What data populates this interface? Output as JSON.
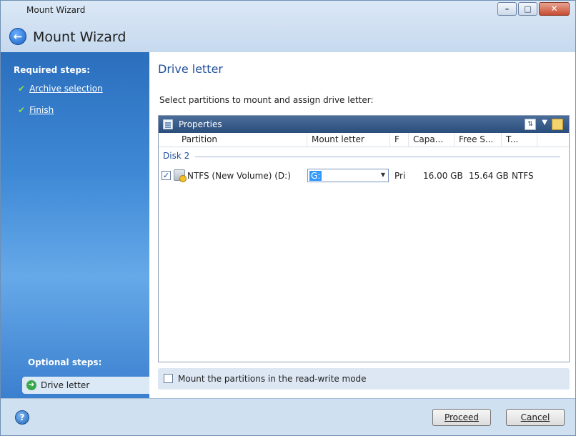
{
  "window": {
    "title": "Mount Wizard",
    "controls": {
      "minimize": "–",
      "maximize": "□",
      "close": "✕"
    }
  },
  "header": {
    "back_icon": "back-arrow-icon",
    "wizard_title": "Mount Wizard"
  },
  "sidebar": {
    "required_heading": "Required steps:",
    "required_steps": [
      {
        "label": "Archive selection",
        "icon": "check-icon"
      },
      {
        "label": "Finish",
        "icon": "check-icon"
      }
    ],
    "optional_heading": "Optional steps:",
    "optional_steps": [
      {
        "label": "Drive letter",
        "icon": "green-arrow-icon"
      }
    ]
  },
  "main": {
    "section_title": "Drive letter",
    "instruction": "Select partitions to mount and assign drive letter:",
    "grid": {
      "toolbar_label": "Properties",
      "columns": [
        "Partition",
        "Mount letter",
        "F",
        "Capa...",
        "Free S...",
        "T..."
      ],
      "group": "Disk 2",
      "rows": [
        {
          "checked": true,
          "partition": "NTFS (New Volume) (D:)",
          "mount_letter": "G:",
          "flags": "Pri",
          "capacity": "16.00 GB",
          "free_space": "15.64 GB",
          "type": "NTFS"
        }
      ]
    },
    "read_write_label": "Mount the partitions in the read-write mode",
    "read_write_checked": false
  },
  "footer": {
    "help_glyph": "?",
    "proceed_label": "Proceed",
    "cancel_label": "Cancel"
  },
  "colors": {
    "accent": "#1f4f9c",
    "sidebar": "#3e89d6",
    "toolbar": "#2a4d7c",
    "check": "#8be04b"
  }
}
